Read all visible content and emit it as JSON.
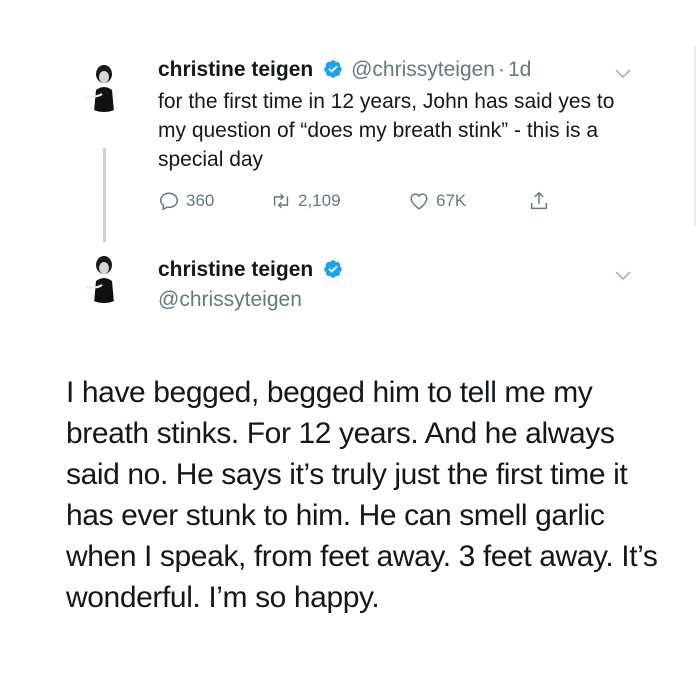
{
  "tweet1": {
    "name": "christine teigen",
    "handle": "@chrissyteigen",
    "separator": "·",
    "time": "1d",
    "text": "for the first time in 12 years, John has said yes to my question of “does my breath stink” - this is a special day",
    "actions": {
      "replies": "360",
      "retweets": "2,109",
      "likes": "67K"
    }
  },
  "tweet2": {
    "name": "christine teigen",
    "handle": "@chrissyteigen",
    "text": "I have begged, begged him to tell me my breath stinks. For 12 years. And he always said no. He says it’s truly just the first time it has ever stunk to him. He can smell garlic when I speak, from feet away. 3 feet away. It’s wonderful. I’m so happy."
  },
  "icons": {
    "verified": "verified-badge-icon",
    "reply": "reply-icon",
    "retweet": "retweet-icon",
    "like": "heart-icon",
    "share": "share-icon",
    "more": "chevron-down-icon"
  },
  "colors": {
    "verified": "#1da1f2",
    "secondary_text": "#657786",
    "thread_line": "#c9d0d6"
  }
}
